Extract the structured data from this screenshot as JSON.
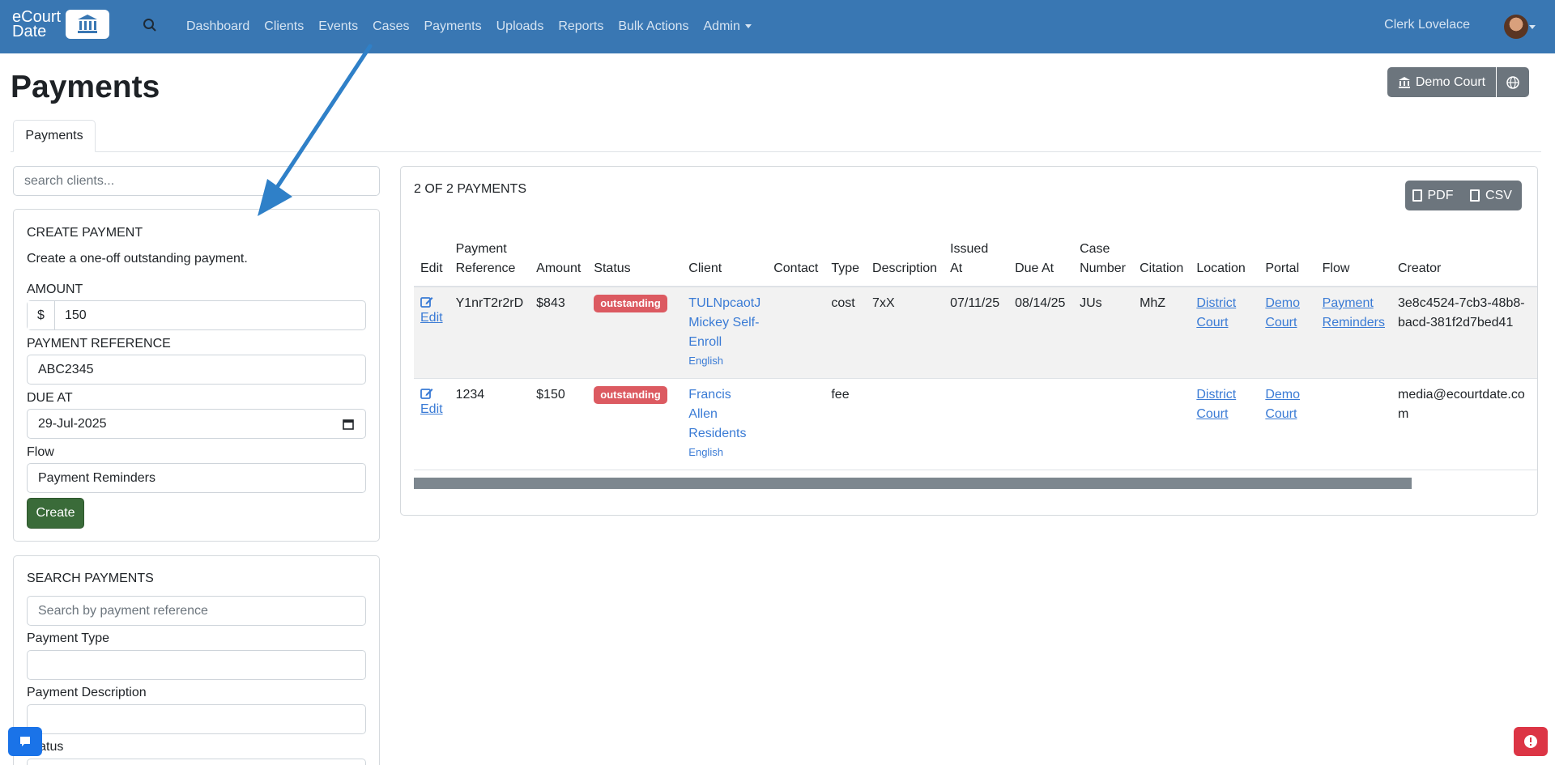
{
  "nav": {
    "brand_line1": "eCourt",
    "brand_line2": "Date",
    "links": [
      "Dashboard",
      "Clients",
      "Events",
      "Cases",
      "Payments",
      "Uploads",
      "Reports",
      "Bulk Actions",
      "Admin"
    ],
    "user": "Clerk Lovelace"
  },
  "header": {
    "title": "Payments",
    "court_button": "Demo Court",
    "tab": "Payments"
  },
  "client_search": {
    "placeholder": "search clients..."
  },
  "create_payment": {
    "title": "CREATE PAYMENT",
    "description": "Create a one-off outstanding payment.",
    "amount_label": "AMOUNT",
    "currency": "$",
    "amount_value": "150",
    "reference_label": "PAYMENT REFERENCE",
    "reference_value": "ABC2345",
    "due_label": "DUE AT",
    "due_value": "29-Jul-2025",
    "flow_label": "Flow",
    "flow_value": "Payment Reminders",
    "create_button": "Create"
  },
  "search_payments": {
    "title": "SEARCH PAYMENTS",
    "reference_placeholder": "Search by payment reference",
    "type_label": "Payment Type",
    "description_label": "Payment Description",
    "status_label": "Status"
  },
  "results": {
    "count": "2 OF 2 PAYMENTS",
    "pdf": "PDF",
    "csv": "CSV",
    "columns": [
      "Edit",
      "Payment Reference",
      "Amount",
      "Status",
      "Client",
      "Contact",
      "Type",
      "Description",
      "Issued At",
      "Due At",
      "Case Number",
      "Citation",
      "Location",
      "Portal",
      "Flow",
      "Creator"
    ],
    "rows": [
      {
        "edit": "Edit",
        "reference": "Y1nrT2r2rD",
        "amount": "$843",
        "status": "outstanding",
        "client": "TULNpcaotJ Mickey Self-Enroll",
        "client_language": "English",
        "contact": "",
        "type": "cost",
        "description": "7xX",
        "issued_at": "07/11/25",
        "due_at": "08/14/25",
        "case_number": "JUs",
        "citation": "MhZ",
        "location": "District Court",
        "portal": "Demo Court",
        "flow": "Payment Reminders",
        "creator": "3e8c4524-7cb3-48b8-bacd-381f2d7bed41"
      },
      {
        "edit": "Edit",
        "reference": "1234",
        "amount": "$150",
        "status": "outstanding",
        "client": "Francis Allen Residents",
        "client_language": "English",
        "contact": "",
        "type": "fee",
        "description": "",
        "issued_at": "",
        "due_at": "",
        "case_number": "",
        "citation": "",
        "location": "District Court",
        "portal": "Demo Court",
        "flow": "",
        "creator": "media@ecourtdate.com"
      }
    ]
  },
  "colors": {
    "navbar": "#3977b3",
    "link": "#3a7bd5",
    "badge": "#dc5a61",
    "create_button": "#3a6b39",
    "arrow": "#2f80c8"
  }
}
